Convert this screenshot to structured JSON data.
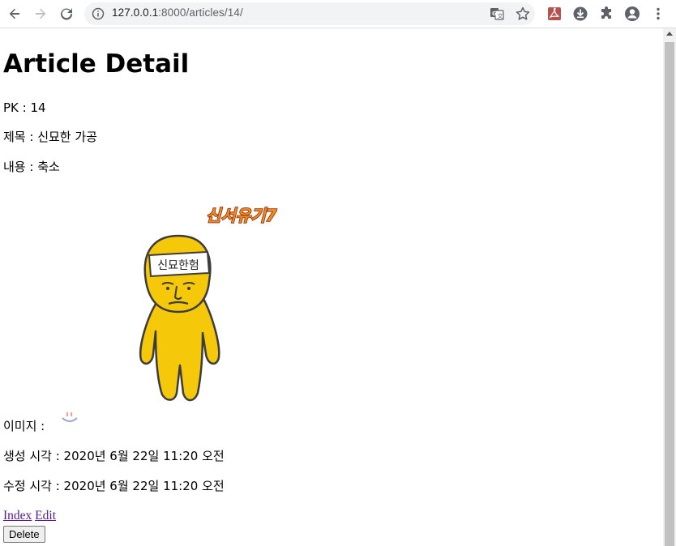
{
  "browser": {
    "url_host": "127.0.0.1",
    "url_rest": ":8000/articles/14/"
  },
  "page": {
    "title": "Article Detail",
    "pk_line": "PK : 14",
    "title_line": "제목 : 신묘한 가공",
    "content_line": "내용 : 축소",
    "image_label": "이미지 :",
    "created_line": "생성 시각 : 2020년 6월 22일 11:20 오전",
    "updated_line": "수정 시각 : 2020년 6월 22일 11:20 오전",
    "image": {
      "logo_text": "신서유기7",
      "headband_text": "신묘한험"
    }
  },
  "links": {
    "index": "Index",
    "edit": "Edit"
  },
  "buttons": {
    "delete": "Delete"
  }
}
